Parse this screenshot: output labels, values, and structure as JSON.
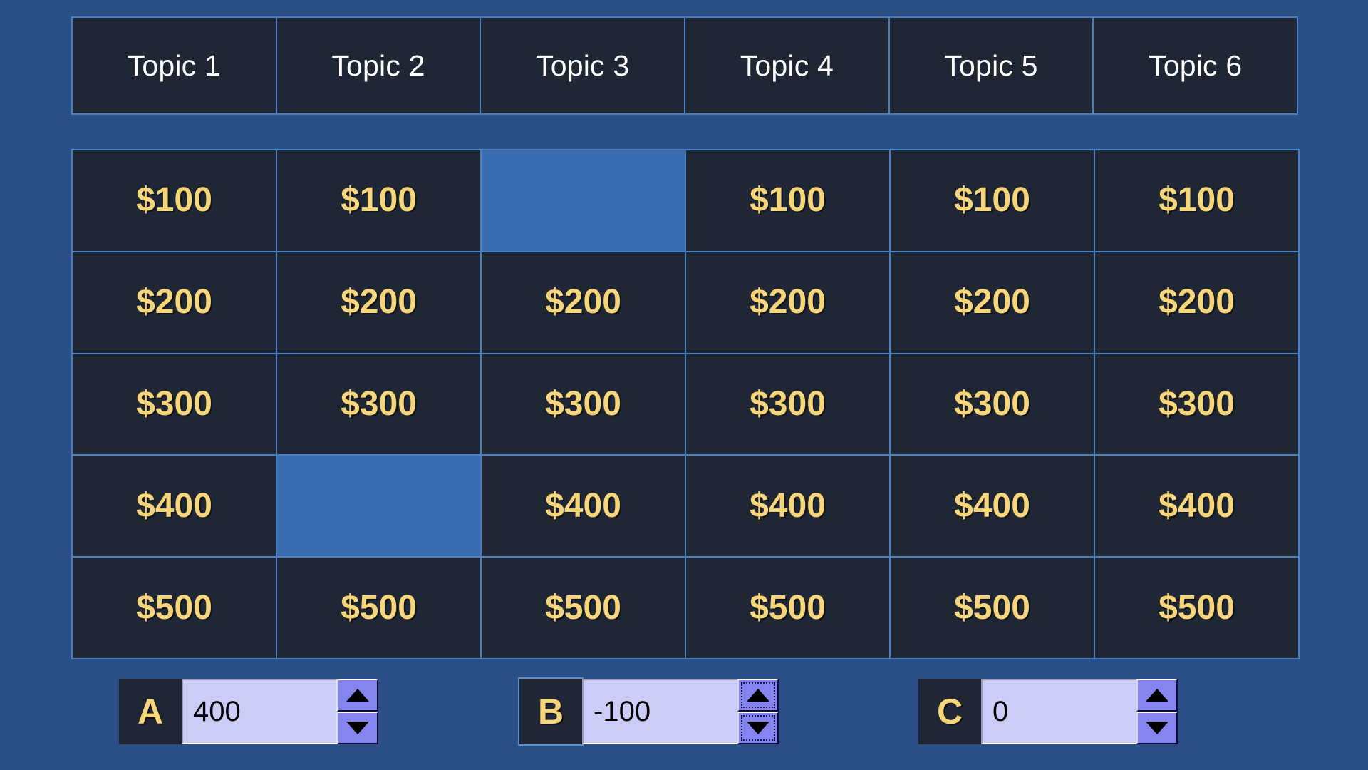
{
  "app": {
    "title": "Jeopardy Game Board",
    "background_color": "#2b4f87",
    "tile_color": "#1e2733",
    "tile_border_color": "#4a7fc1",
    "value_text_color": "#f7d57a",
    "header_text_color": "#ffffff",
    "empty_cell_color": "#3a6cb0"
  },
  "board": {
    "columns": [
      {
        "label": "Topic 1"
      },
      {
        "label": "Topic 2"
      },
      {
        "label": "Topic 3"
      },
      {
        "label": "Topic 4"
      },
      {
        "label": "Topic 5"
      },
      {
        "label": "Topic 6"
      }
    ],
    "rows": [
      {
        "cells": [
          {
            "value": "$100",
            "played": false
          },
          {
            "value": "$100",
            "played": false
          },
          {
            "value": "",
            "played": true
          },
          {
            "value": "$100",
            "played": false
          },
          {
            "value": "$100",
            "played": false
          },
          {
            "value": "$100",
            "played": false
          }
        ]
      },
      {
        "cells": [
          {
            "value": "$200",
            "played": false
          },
          {
            "value": "$200",
            "played": false
          },
          {
            "value": "$200",
            "played": false
          },
          {
            "value": "$200",
            "played": false
          },
          {
            "value": "$200",
            "played": false
          },
          {
            "value": "$200",
            "played": false
          }
        ]
      },
      {
        "cells": [
          {
            "value": "$300",
            "played": false
          },
          {
            "value": "$300",
            "played": false
          },
          {
            "value": "$300",
            "played": false
          },
          {
            "value": "$300",
            "played": false
          },
          {
            "value": "$300",
            "played": false
          },
          {
            "value": "$300",
            "played": false
          }
        ]
      },
      {
        "cells": [
          {
            "value": "$400",
            "played": false
          },
          {
            "value": "",
            "played": true
          },
          {
            "value": "$400",
            "played": false
          },
          {
            "value": "$400",
            "played": false
          },
          {
            "value": "$400",
            "played": false
          },
          {
            "value": "$400",
            "played": false
          }
        ]
      },
      {
        "cells": [
          {
            "value": "$500",
            "played": false
          },
          {
            "value": "$500",
            "played": false
          },
          {
            "value": "$500",
            "played": false
          },
          {
            "value": "$500",
            "played": false
          },
          {
            "value": "$500",
            "played": false
          },
          {
            "value": "$500",
            "played": false
          }
        ]
      }
    ]
  },
  "players": [
    {
      "letter": "A",
      "score": "400",
      "focused": false
    },
    {
      "letter": "B",
      "score": "-100",
      "focused": true
    },
    {
      "letter": "C",
      "score": "0",
      "focused": false
    }
  ],
  "spinner": {
    "increment_icon": "triangle-up-icon",
    "decrement_icon": "triangle-down-icon",
    "field_bg_color": "#ccccf8",
    "button_bg_color": "#8585f2"
  }
}
